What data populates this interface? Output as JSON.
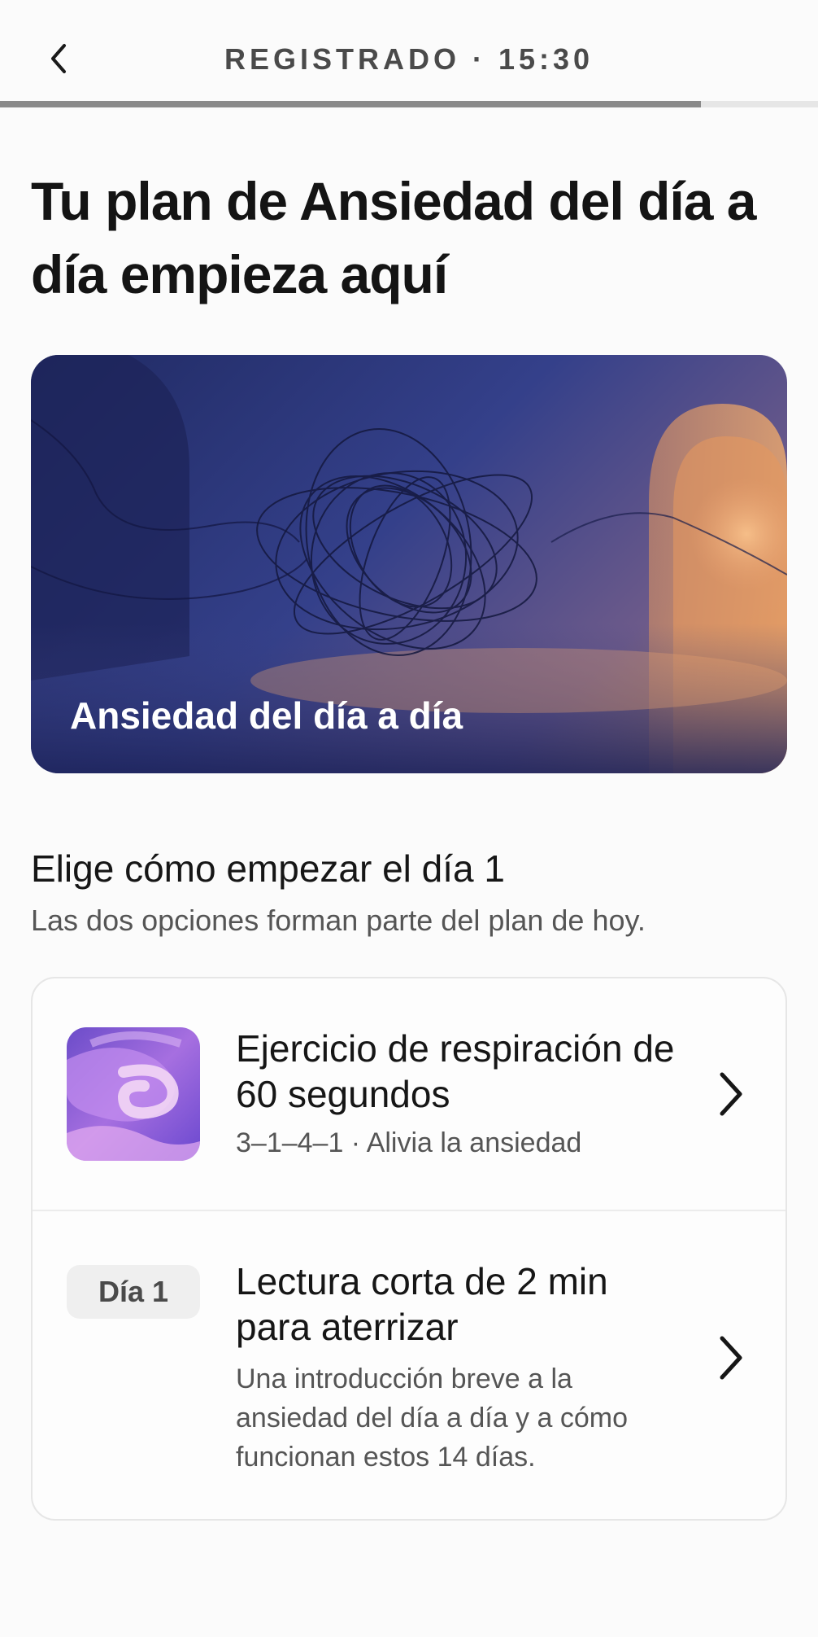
{
  "header": {
    "title": "REGISTRADO · 15:30",
    "progress_fraction": 0.857,
    "back_icon": "chevron-left-icon"
  },
  "page": {
    "title": "Tu plan de Ansiedad del día a día empieza aquí"
  },
  "hero": {
    "label": "Ansiedad del día a día"
  },
  "section": {
    "title": "Elige cómo empezar el día 1",
    "subtitle": "Las dos opciones forman parte del plan de hoy."
  },
  "options": [
    {
      "title": "Ejercicio de respiración de 60 segundos",
      "subtitle": "3–1–4–1 · Alivia la ansiedad",
      "icon": "breathing-swirl-thumbnail"
    },
    {
      "badge": "Día 1",
      "title": "Lectura corta de 2 min para aterrizar",
      "subtitle": "Una introducción breve a la ansiedad del día a día y a cómo funcionan estos 14 días."
    }
  ],
  "colors": {
    "progress_fill": "#8a8a8a",
    "progress_track": "#e6e6e6",
    "hero_deep": "#202a63",
    "hero_warm": "#c78a5c",
    "thumb_purple": "#8d5ad8"
  }
}
